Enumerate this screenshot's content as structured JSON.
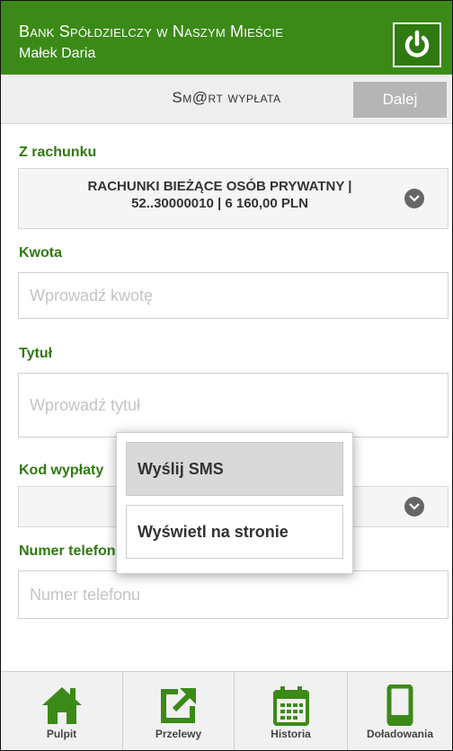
{
  "header": {
    "bank_name": "Bank Spółdzielczy w Naszym Mieście",
    "user_name": "Małek Daria"
  },
  "titlebar": {
    "title": "Sm@rt wypłata",
    "next_label": "Dalej"
  },
  "form": {
    "from_account_label": "Z rachunku",
    "from_account_line1": "RACHUNKI BIEŻĄCE OSÓB PRYWATNY |",
    "from_account_line2": "52..30000010 | 6 160,00 PLN",
    "amount_label": "Kwota",
    "amount_placeholder": "Wprowadź kwotę",
    "title_label": "Tytuł",
    "title_placeholder": "Wprowadź tytuł",
    "code_label": "Kod wypłaty",
    "phone_label": "Numer telefonu",
    "phone_placeholder": "Numer telefonu"
  },
  "popup": {
    "options": [
      "Wyślij SMS",
      "Wyświetl na stronie"
    ],
    "selected_index": 0
  },
  "bottom_nav": [
    {
      "label": "Pulpit",
      "icon": "home-icon"
    },
    {
      "label": "Przelewy",
      "icon": "transfer-icon"
    },
    {
      "label": "Historia",
      "icon": "calendar-icon"
    },
    {
      "label": "Doładowania",
      "icon": "phone-icon"
    }
  ],
  "colors": {
    "brand_green": "#3b8a18",
    "label_green": "#2f7a10"
  }
}
